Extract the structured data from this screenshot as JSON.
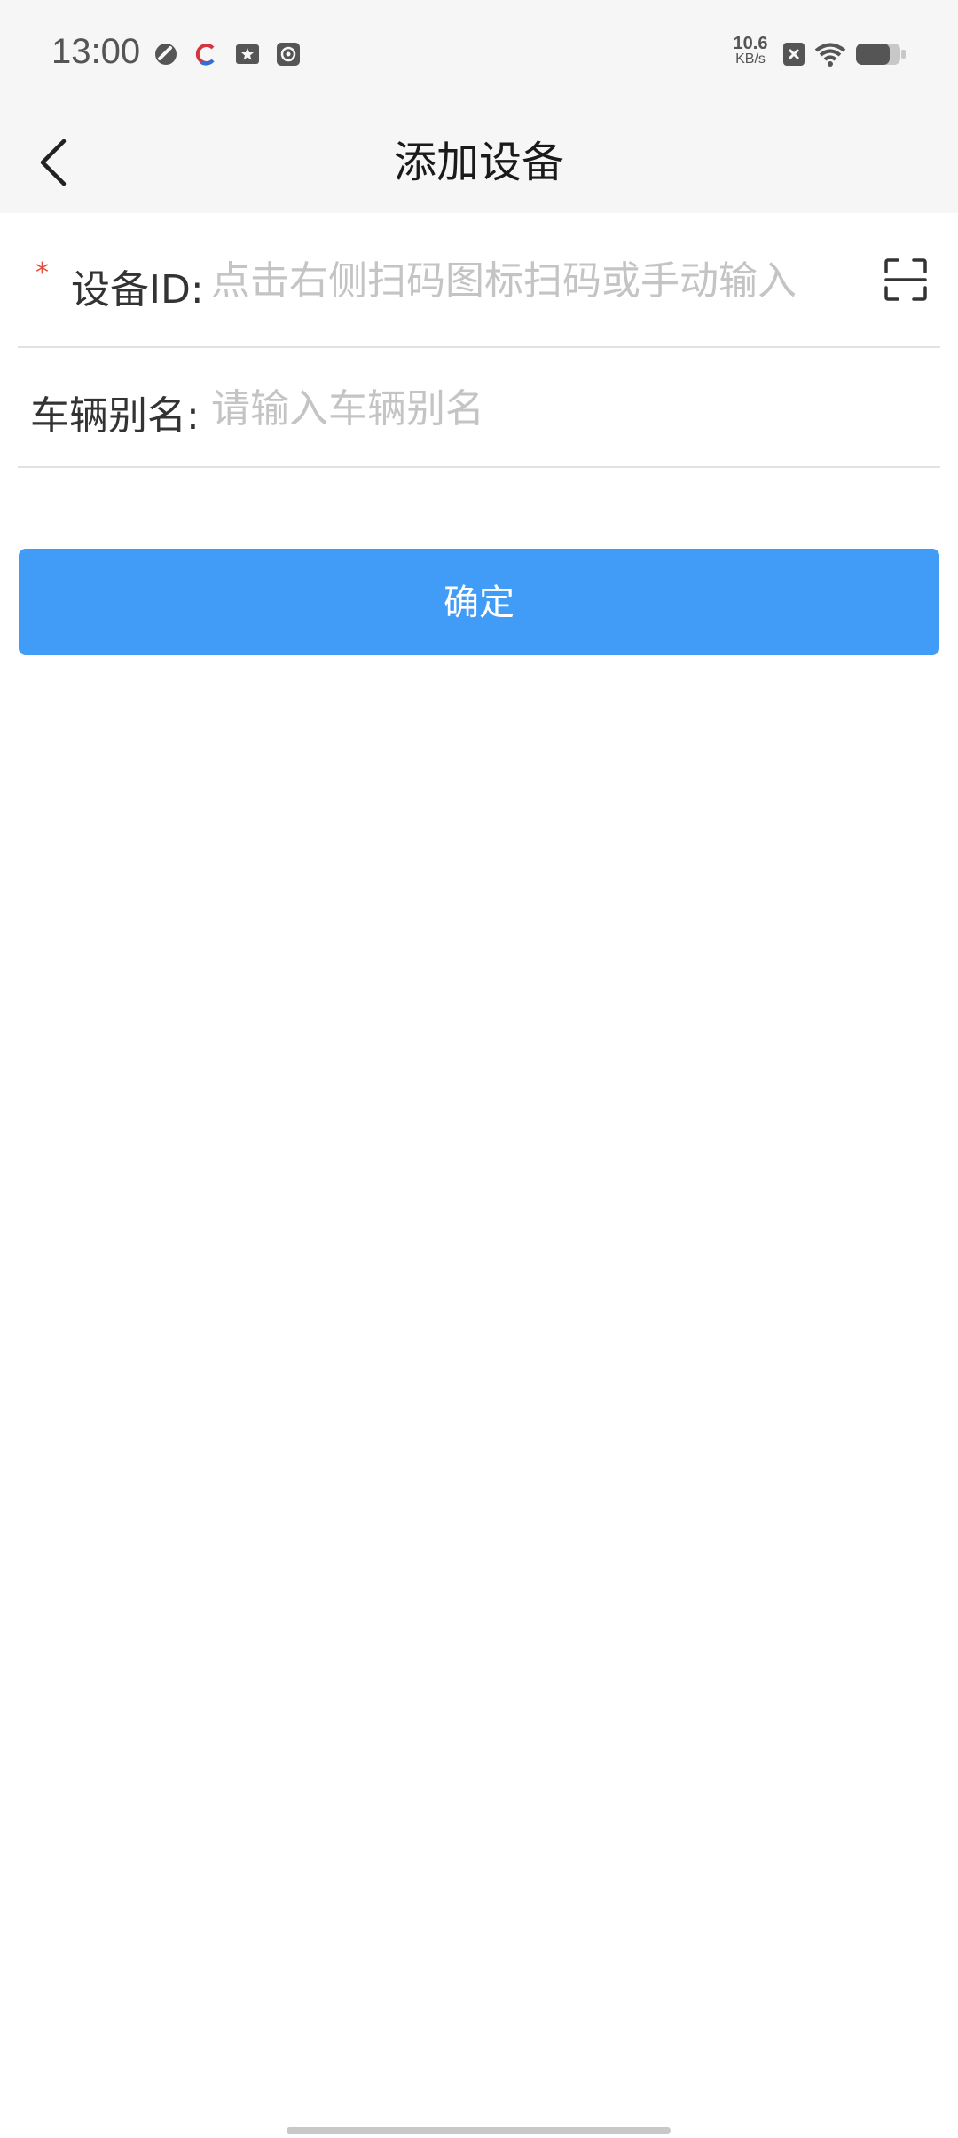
{
  "status_bar": {
    "time": "13:00",
    "net_speed_value": "10.6",
    "net_speed_unit": "KB/s",
    "icons": [
      "link-app-icon",
      "c-app-icon",
      "star-app-icon",
      "settings-app-icon",
      "close-box-icon",
      "wifi-icon",
      "battery-icon"
    ]
  },
  "nav": {
    "title": "添加设备",
    "back_icon": "chevron-left-icon"
  },
  "form": {
    "device_id": {
      "required_mark": "*",
      "label": "设备ID:",
      "value": "",
      "placeholder": "点击右侧扫码图标扫码或手动输入",
      "scan_icon": "scan-icon"
    },
    "vehicle_alias": {
      "label": "车辆别名:",
      "value": "",
      "placeholder": "请输入车辆别名"
    }
  },
  "confirm_label": "确定",
  "colors": {
    "accent": "#409cf7",
    "required": "#e64a3b",
    "placeholder": "#c4c4c4",
    "header_bg": "#f6f6f6"
  }
}
